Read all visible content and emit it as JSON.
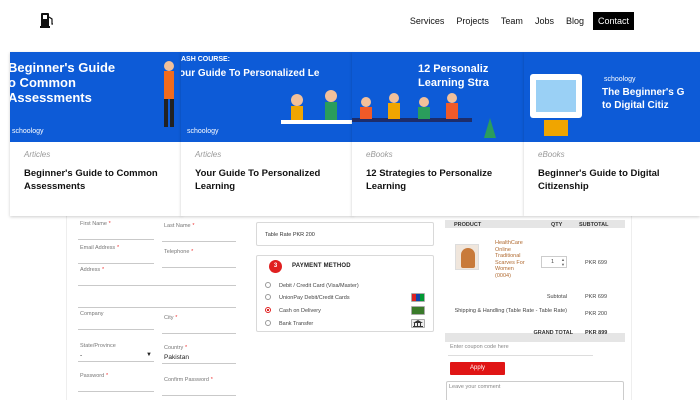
{
  "nav": {
    "logo_icon": "fuel-pump-icon",
    "items": [
      "Services",
      "Projects",
      "Team",
      "Jobs",
      "Blog",
      "Contact"
    ]
  },
  "cards": [
    {
      "banner_title": "Beginner's Guide\no Common\nAssessments",
      "brand": "schoology",
      "category": "Articles",
      "title": "Beginner's Guide to Common Assessments"
    },
    {
      "banner_kicker": "ASH COURSE:",
      "banner_title": "our Guide To Personalized Le",
      "brand": "schoology",
      "category": "Articles",
      "title": "Your Guide To Personalized Learning"
    },
    {
      "banner_title": "12 Personaliz\nLearning Stra",
      "category": "eBooks",
      "title": "12 Strategies to Personalize Learning"
    },
    {
      "banner_title": "The Beginner's G\nto Digital Citiz",
      "brand": "schoology",
      "category": "eBooks",
      "title": "Beginner's Guide to Digital Citizenship"
    }
  ],
  "form": {
    "first_name": "First Name",
    "last_name": "Last Name",
    "email": "Email Address",
    "phone": "Telephone",
    "address": "Address",
    "company": "Company",
    "city": "City",
    "state": "State/Province",
    "state_value": "-",
    "country": "Country",
    "country_value": "Pakistan",
    "password": "Password",
    "confirm_password": "Confirm Password",
    "required_mark": "*"
  },
  "shipping": {
    "table_rate": "Table Rate PKR 200"
  },
  "payment": {
    "step": "3",
    "heading": "PAYMENT METHOD",
    "options": [
      "Debit / Credit Card (Visa/Master)",
      "UnionPay Debit/Credit Cards",
      "Cash on Delivery",
      "Bank Transfer"
    ],
    "selected_index": 2
  },
  "summary": {
    "col_product": "PRODUCT",
    "col_qty": "QTY",
    "col_subtotal": "SUBTOTAL",
    "item_name": "HealthCare\nOnline\nTraditional\nScarves For\nWomen\n(0004)",
    "item_qty": "1",
    "item_subtotal": "PKR 699",
    "subtotal_label": "Subtotal",
    "subtotal_value": "PKR 699",
    "shipping_label": "Shipping & Handling (Table Rate - Table Rate)",
    "shipping_value": "PKR 200",
    "grand_label": "GRAND TOTAL",
    "grand_value": "PKR 899"
  },
  "coupon": {
    "placeholder": "Enter coupon code here",
    "apply": "Apply"
  },
  "comment": {
    "placeholder": "Leave your comment"
  },
  "colors": {
    "banner_blue": "#0d5bd7",
    "accent_red": "#e02020"
  }
}
